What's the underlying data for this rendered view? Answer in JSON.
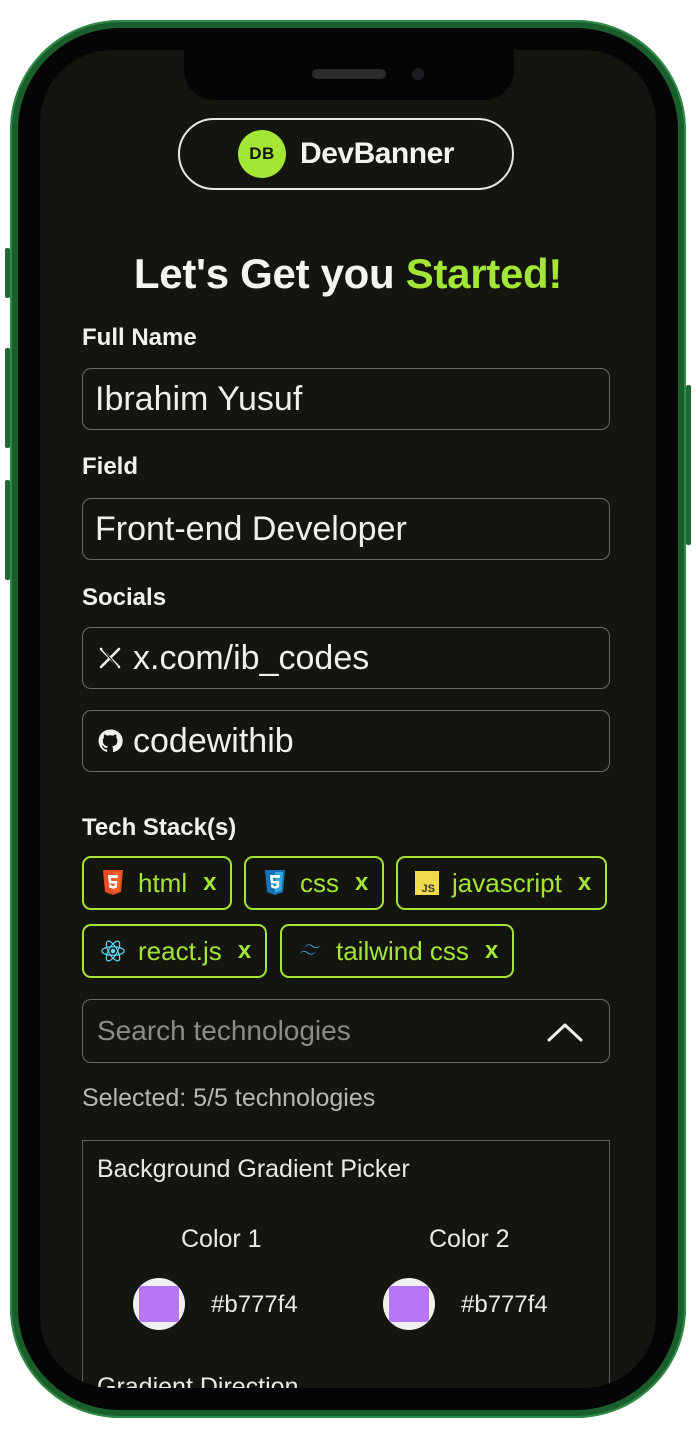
{
  "app": {
    "logo_initials": "DB",
    "logo_name": "DevBanner"
  },
  "headline": {
    "main": "Let's Get you ",
    "accent": "Started!"
  },
  "form": {
    "full_name_label": "Full Name",
    "full_name_value": "Ibrahim Yusuf",
    "field_label": "Field",
    "field_value": "Front-end Developer",
    "socials_label": "Socials",
    "socials": [
      {
        "icon": "x-logo-icon",
        "value": "x.com/ib_codes"
      },
      {
        "icon": "github-icon",
        "value": "codewithib"
      }
    ],
    "tech_stack_label": "Tech Stack(s)",
    "tech_stack": [
      {
        "icon": "html5-icon",
        "label": "html",
        "remove": "x"
      },
      {
        "icon": "css3-icon",
        "label": "css",
        "remove": "x"
      },
      {
        "icon": "javascript-icon",
        "label": "javascript",
        "remove": "x"
      },
      {
        "icon": "react-icon",
        "label": "react.js",
        "remove": "x"
      },
      {
        "icon": "tailwind-icon",
        "label": "tailwind css",
        "remove": "x"
      }
    ],
    "search_placeholder": "Search technologies",
    "selected_text": "Selected: 5/5 technologies"
  },
  "gradient": {
    "title": "Background Gradient Picker",
    "color1_label": "Color 1",
    "color1_value": "#b777f4",
    "color2_label": "Color 2",
    "color2_value": "#b777f4",
    "direction_label": "Gradient Direction"
  },
  "colors": {
    "accent": "#a3e635",
    "background": "#151510",
    "phone_frame": "#1a5e2c",
    "swatch": "#b777f4"
  }
}
